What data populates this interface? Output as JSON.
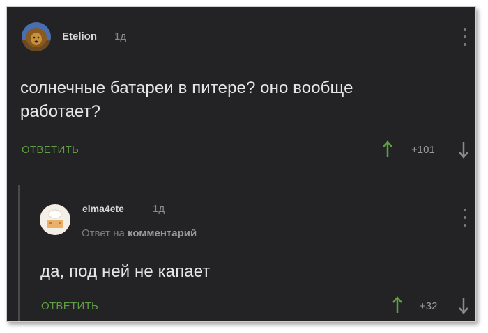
{
  "comments": [
    {
      "username": "Etelion",
      "age": "1д",
      "text_lines": [
        "солнечные батареи в питере? оно вообще",
        "работает?"
      ],
      "reply_label": "ОТВЕТИТЬ",
      "rating": "+101"
    },
    {
      "username": "elma4ete",
      "age": "1д",
      "reply_to_prefix": "Ответ на",
      "reply_to_target": "комментарий",
      "text_lines": [
        "да, под ней не капает"
      ],
      "reply_label": "ОТВЕТИТЬ",
      "rating": "+32"
    }
  ],
  "colors": {
    "background": "#232325",
    "accent_green": "#5f9e46",
    "text": "#e6e6e6",
    "muted": "#8a8a8a"
  },
  "icons": {
    "upvote": "up-arrow-icon",
    "downvote": "down-arrow-icon",
    "menu": "vertical-dots-icon"
  }
}
